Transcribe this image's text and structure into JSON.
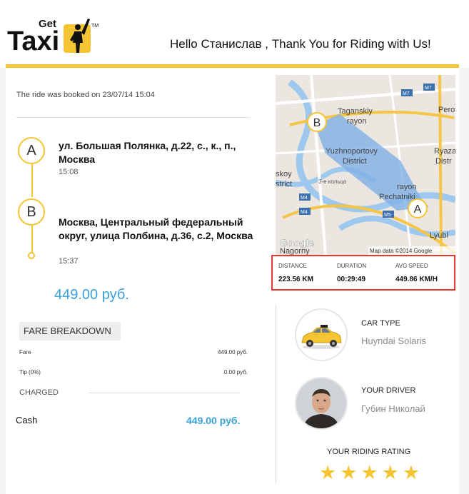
{
  "header": {
    "brand_small": "Get",
    "brand_big": "Taxi",
    "trademark": "TM",
    "greeting": "Hello Станислав , Thank You for Riding with Us!"
  },
  "ride": {
    "booked_text": "The ride was booked on 23/07/14 15:04",
    "pickup": {
      "marker": "A",
      "address": "ул. Большая Полянка, д.22, с., к., п., Москва",
      "time": "15:08"
    },
    "dropoff": {
      "marker": "B",
      "address": "Москва, Центральный федеральный округ, улица Полбина, д.36, с.2, Москва",
      "time": "15:37"
    },
    "total": "449.00 руб."
  },
  "fare": {
    "title": "FARE BREAKDOWN",
    "rows": [
      {
        "label": "Fare",
        "value": "449.00 руб."
      },
      {
        "label": "Tip (0%)",
        "value": "0.00 руб."
      }
    ],
    "charged_label": "CHARGED",
    "payment_method": "Cash",
    "charged_amount": "449.00 руб."
  },
  "map": {
    "labels": [
      "Taganskiy",
      "rayon",
      "Yuzhnoportovy",
      "District",
      "rayon",
      "Pechatniki",
      "Lyubl",
      "Ryazar",
      "Distr",
      "Perov",
      "skoy",
      "strict",
      "Nagorny",
      "3-е кольцо",
      "M7",
      "M7",
      "M4",
      "M4",
      "M5"
    ],
    "markers": [
      "B",
      "A"
    ],
    "attribution": "Map data ©2014 Google",
    "google": "Google",
    "colors": {
      "water": "#9ec8ee",
      "route_area": "#7fb0e6",
      "road": "#f4c546"
    }
  },
  "stats": {
    "distance": {
      "label": "DISTANCE",
      "value": "223.56 KM"
    },
    "duration": {
      "label": "DURATION",
      "value": "00:29:49"
    },
    "speed": {
      "label": "AVG SPEED",
      "value": "449.86 KM/H"
    }
  },
  "car": {
    "title": "CAR TYPE",
    "value": "Huyndai Solaris",
    "icon": "taxi-car-icon"
  },
  "driver": {
    "title": "YOUR DRIVER",
    "value": "Губин Николай",
    "icon": "driver-photo"
  },
  "rating": {
    "title": "YOUR RIDING RATING",
    "stars": 5,
    "max": 5
  },
  "colors": {
    "accent": "#f6c533",
    "price": "#3aa0d8",
    "highlight_border": "#e4392f"
  }
}
